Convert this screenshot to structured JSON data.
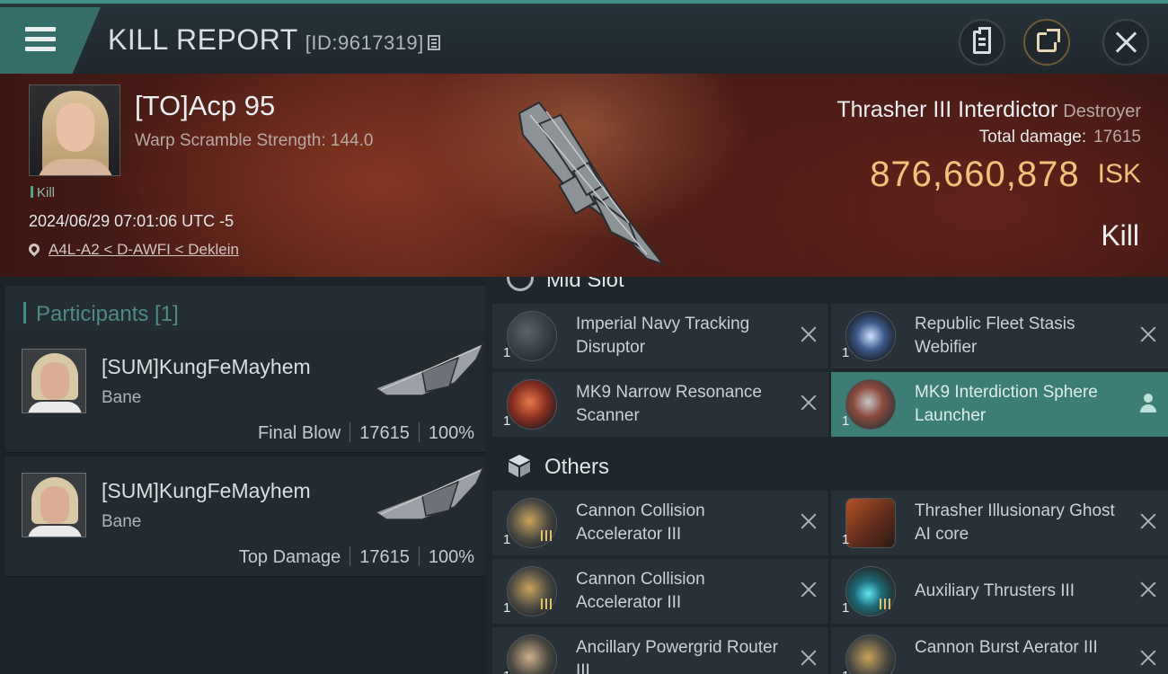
{
  "header": {
    "title": "KILL REPORT",
    "report_id": "[ID:9617319]",
    "icons": [
      "menu-icon",
      "copy-icon",
      "clipboard-icon",
      "share-icon",
      "close-icon"
    ]
  },
  "victim": {
    "name": "[TO]Acp 95",
    "scramble": "Warp Scramble Strength: 144.0",
    "tag": "Kill",
    "datetime": "2024/06/29 07:01:06 UTC -5",
    "location": "A4L-A2 < D-AWFI < Deklein",
    "ship_name": "Thrasher III Interdictor",
    "ship_class": "Destroyer",
    "damage_label": "Total damage:",
    "damage_value": "17615",
    "isk_amount": "876,660,878",
    "isk_unit": "ISK",
    "result": "Kill"
  },
  "participants": {
    "title": "Participants [1]",
    "list": [
      {
        "name": "[SUM]KungFeMayhem",
        "ship": "Bane",
        "role": "Final Blow",
        "damage": "17615",
        "percent": "100%"
      },
      {
        "name": "[SUM]KungFeMayhem",
        "ship": "Bane",
        "role": "Top Damage",
        "damage": "17615",
        "percent": "100%"
      }
    ]
  },
  "fitting": {
    "mid_slot_title": "Mid Slot",
    "others_title": "Others",
    "mid_items": [
      {
        "qty": "1",
        "name": "Imperial Navy Tracking Disruptor"
      },
      {
        "qty": "1",
        "name": "Republic Fleet Stasis Webifier"
      },
      {
        "qty": "1",
        "name": "MK9 Narrow Resonance Scanner"
      },
      {
        "qty": "1",
        "name": "MK9 Interdiction Sphere Launcher"
      }
    ],
    "other_items": [
      {
        "qty": "1",
        "name": "Cannon Collision Accelerator III"
      },
      {
        "qty": "1",
        "name": "Thrasher Illusionary Ghost AI core"
      },
      {
        "qty": "1",
        "name": "Cannon Collision Accelerator III"
      },
      {
        "qty": "1",
        "name": "Auxiliary Thrusters III"
      },
      {
        "qty": "1",
        "name": "Ancillary Powergrid Router III"
      },
      {
        "qty": "1",
        "name": "Cannon Burst Aerator III"
      }
    ]
  },
  "colors": {
    "accent": "#3f8f86",
    "isk": "#f0c27a",
    "selected": "#3e7c76"
  }
}
